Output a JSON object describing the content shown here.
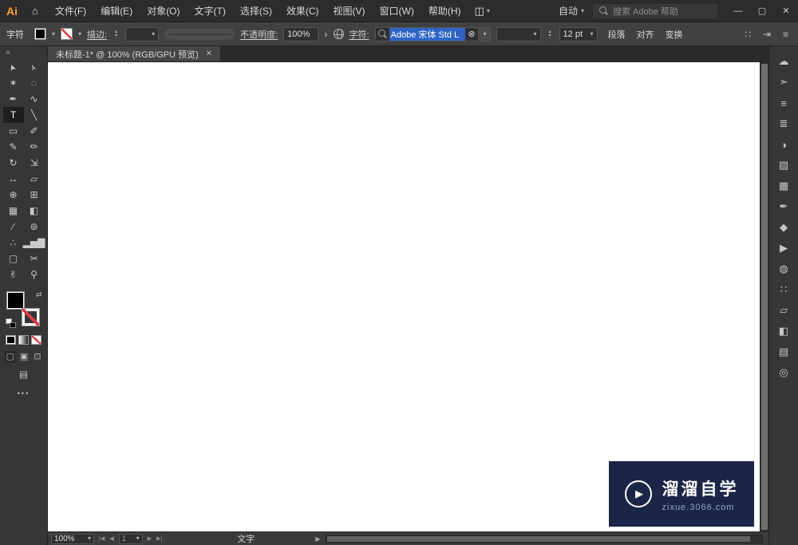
{
  "colors": {
    "ui_background": "#414141",
    "titlebar_background": "#2c2c2c",
    "selection_blue": "#2e64c5",
    "stroke_none_red": "#e23b3b",
    "watermark_background": "#1b2547",
    "logo_orange": "#ff9c2e"
  },
  "icons": {
    "home": "⌂",
    "layout": "◫",
    "caret": "▾",
    "stepper_up": "▴",
    "stepper_down": "▾",
    "arrow_right": "›",
    "clear": "⊗",
    "swap": "⇄",
    "collapse": "«",
    "ellipsis": "•••",
    "screen_mode": "▤",
    "menu": "≡",
    "grid_dots": "∷",
    "tab_arrow": "⇥",
    "play": "▶",
    "nav_first": "|◀",
    "nav_prev": "◀",
    "nav_next": "▶",
    "nav_last": "▶|"
  },
  "titlebar": {
    "logo": "Ai",
    "menus": [
      "文件(F)",
      "编辑(E)",
      "对象(O)",
      "文字(T)",
      "选择(S)",
      "效果(C)",
      "视图(V)",
      "窗口(W)",
      "帮助(H)"
    ],
    "workspace": "自动",
    "search_placeholder": "搜索 Adobe 帮助",
    "window_controls": {
      "minimize": "—",
      "restore": "▢",
      "close": "✕"
    }
  },
  "controlbar": {
    "context_label": "字符",
    "stroke_label": "描边:",
    "opacity_label": "不透明度:",
    "opacity_value": "100%",
    "character_label": "字符:",
    "font_name": "Adobe 宋体 Std L",
    "font_size": "12 pt",
    "links": [
      "段落",
      "对齐",
      "变换"
    ]
  },
  "document": {
    "tab_title": "未标题-1* @ 100% (RGB/GPU 预览)",
    "close_icon": "✕"
  },
  "toolbar": {
    "tools": [
      {
        "name": "selection-tool",
        "glyph": "➤",
        "cls": "cursor"
      },
      {
        "name": "direct-selection-tool",
        "glyph": "➢",
        "cls": "cursor"
      },
      {
        "name": "magic-wand-tool",
        "glyph": "✶"
      },
      {
        "name": "lasso-tool",
        "glyph": "◌"
      },
      {
        "name": "pen-tool",
        "glyph": "✒"
      },
      {
        "name": "curvature-tool",
        "glyph": "∿"
      },
      {
        "name": "type-tool",
        "glyph": "T",
        "active": true
      },
      {
        "name": "line-segment-tool",
        "glyph": "╲"
      },
      {
        "name": "rectangle-tool",
        "glyph": "▭"
      },
      {
        "name": "paintbrush-tool",
        "glyph": "✐"
      },
      {
        "name": "shaper-tool",
        "glyph": "✎"
      },
      {
        "name": "pencil-tool",
        "glyph": "✏"
      },
      {
        "name": "rotate-tool",
        "glyph": "↻"
      },
      {
        "name": "scale-tool",
        "glyph": "⇲"
      },
      {
        "name": "width-tool",
        "glyph": "↔"
      },
      {
        "name": "free-transform-tool",
        "glyph": "▱"
      },
      {
        "name": "shape-builder-tool",
        "glyph": "⊕"
      },
      {
        "name": "perspective-grid-tool",
        "glyph": "⊞"
      },
      {
        "name": "mesh-tool",
        "glyph": "▦"
      },
      {
        "name": "gradient-tool",
        "glyph": "◧"
      },
      {
        "name": "eyedropper-tool",
        "glyph": "∕"
      },
      {
        "name": "blend-tool",
        "glyph": "⊚"
      },
      {
        "name": "symbol-sprayer-tool",
        "glyph": "∴"
      },
      {
        "name": "column-graph-tool",
        "glyph": "▂▅▇"
      },
      {
        "name": "artboard-tool",
        "glyph": "▢"
      },
      {
        "name": "slice-tool",
        "glyph": "✂"
      },
      {
        "name": "hand-tool",
        "glyph": "✌"
      },
      {
        "name": "zoom-tool",
        "glyph": "⚲"
      }
    ],
    "draw_modes": [
      {
        "name": "draw-normal-mode",
        "glyph": "▢"
      },
      {
        "name": "draw-behind-mode",
        "glyph": "▣"
      },
      {
        "name": "draw-inside-mode",
        "glyph": "⊡"
      }
    ]
  },
  "right_dock": {
    "icons": [
      {
        "name": "libraries-panel-icon",
        "glyph": "☁"
      },
      {
        "name": "share-panel-icon",
        "glyph": "➣"
      },
      {
        "name": "properties-panel-icon",
        "glyph": "≡"
      },
      {
        "name": "character-panel-icon",
        "glyph": "≣"
      },
      {
        "name": "gradient-panel-icon",
        "glyph": "◑"
      },
      {
        "name": "transparency-panel-icon",
        "glyph": "▧"
      },
      {
        "name": "swatches-panel-icon",
        "glyph": "▦"
      },
      {
        "name": "brushes-panel-icon",
        "glyph": "✒"
      },
      {
        "name": "symbols-panel-icon",
        "glyph": "◆"
      },
      {
        "name": "actions-panel-icon",
        "glyph": "▶"
      },
      {
        "name": "appearance-panel-icon",
        "glyph": "◍"
      },
      {
        "name": "align-panel-icon",
        "glyph": "∷"
      },
      {
        "name": "transform-panel-icon",
        "glyph": "▱"
      },
      {
        "name": "pathfinder-panel-icon",
        "glyph": "◧"
      },
      {
        "name": "layers-panel-icon",
        "glyph": "▤"
      },
      {
        "name": "asset-export-panel-icon",
        "glyph": "◎"
      }
    ]
  },
  "statusbar": {
    "zoom": "100%",
    "artboard": "1",
    "status_text": "文字"
  },
  "watermark": {
    "title": "溜溜自学",
    "url": "zixue.3066.com"
  }
}
